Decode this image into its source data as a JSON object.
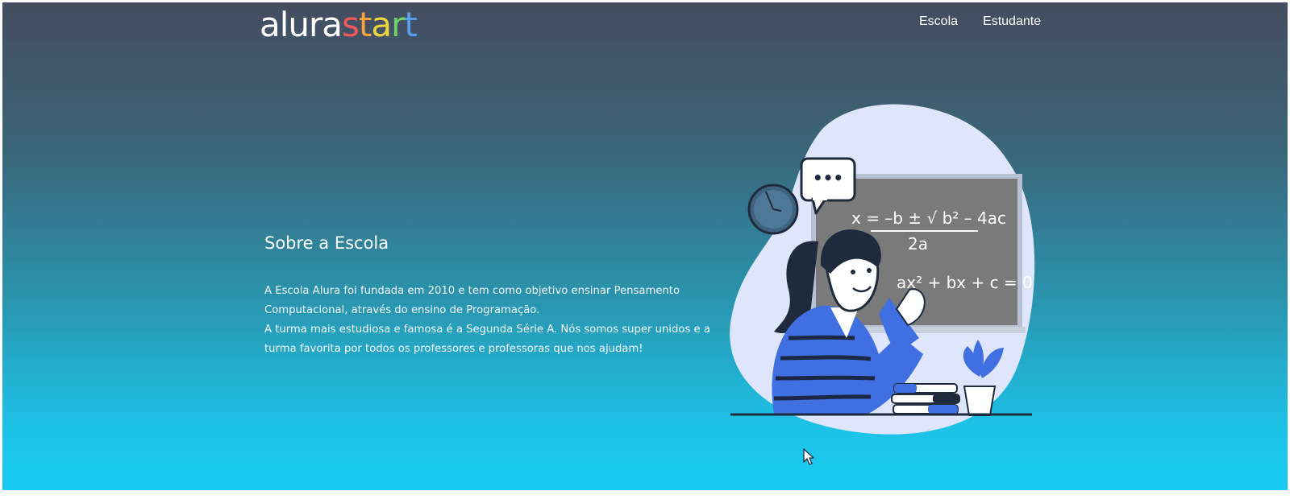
{
  "logo": {
    "first": "alura",
    "second_letters": [
      "s",
      "t",
      "a",
      "r",
      "t"
    ],
    "second_colors": [
      "#f25a5a",
      "#f7a23c",
      "#ecd63f",
      "#6fd36a",
      "#5aa0f0"
    ]
  },
  "nav": {
    "items": [
      "Escola",
      "Estudante"
    ]
  },
  "about": {
    "title": "Sobre a Escola",
    "paragraph1": "A Escola Alura foi fundada em 2010 e tem como objetivo ensinar Pensamento Computacional, através do ensino de Programação.",
    "paragraph2": "A turma mais estudiosa e famosa é a Segunda Série A. Nós somos super unidos e a turma favorita por todos os professores e professoras que nos ajudam!"
  },
  "illustration": {
    "formula1": "x = –b ± √ b² – 4ac",
    "formula1_denominator": "2a",
    "formula2": "ax² + bx + c = 0",
    "speech_bubble": "•••"
  },
  "colors": {
    "blob": "#dfe6fb",
    "board": "#7a7a7a",
    "shirt": "#3f6fe0",
    "stripes": "#1c2748"
  }
}
